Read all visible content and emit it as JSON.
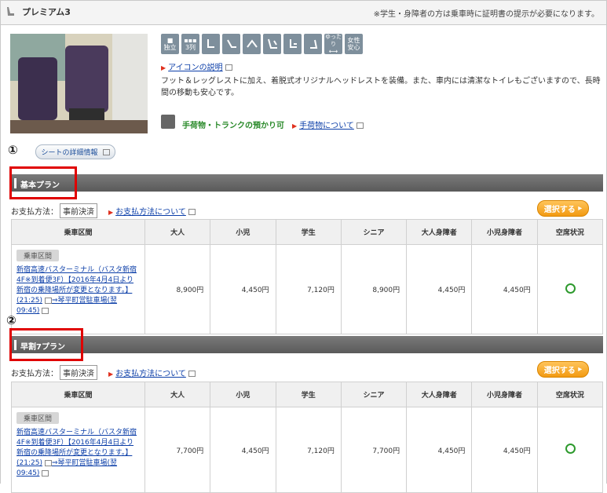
{
  "header": {
    "title": "プレミアム3",
    "notice": "※学生・身障者の方は乗車時に証明書の提示が必要になります。"
  },
  "icons": [
    {
      "name": "private-seat-icon",
      "label": "独立"
    },
    {
      "name": "three-row-icon",
      "label": "3列"
    },
    {
      "name": "seat-icon",
      "label": ""
    },
    {
      "name": "legrest-icon",
      "label": ""
    },
    {
      "name": "footrest-icon",
      "label": ""
    },
    {
      "name": "reclining-icon",
      "label": ""
    },
    {
      "name": "headrest-icon",
      "label": ""
    },
    {
      "name": "seat-back-icon",
      "label": ""
    },
    {
      "name": "spacious-icon",
      "label": "ゆったり"
    },
    {
      "name": "women-safe-icon",
      "label": "女性安心"
    }
  ],
  "icon_help_link": "アイコンの説明",
  "description": "フット＆レッグレストに加え、着脱式オリジナルヘッドレストを装備。また、車内には清潔なトイレもございますので、長時間の移動も安心です。",
  "baggage": {
    "label": "手荷物・トランクの預かり可",
    "link": "手荷物について"
  },
  "seat_button": "シートの詳細情報",
  "markers": {
    "one": "①",
    "two": "②"
  },
  "plans": [
    {
      "name": "基本プラン",
      "payment_label": "お支払方法：",
      "payment_value": "事前決済",
      "payment_link": "お支払方法について",
      "select_label": "選択する",
      "headers": [
        "乗車区間",
        "大人",
        "小児",
        "学生",
        "シニア",
        "大人身障者",
        "小児身障者",
        "空席状況"
      ],
      "row": {
        "tag": "乗車区間",
        "route": "新宿高速バスターミナル（バスタ新宿4F※到着便3F）【2016年4月4日より新宿の乗降場所が変更となります。】(21:25)",
        "dest": "⇒琴平町営駐車場(翌09:45)",
        "prices": [
          "8,900円",
          "4,450円",
          "7,120円",
          "8,900円",
          "4,450円",
          "4,450円"
        ]
      }
    },
    {
      "name": "早割7プラン",
      "payment_label": "お支払方法：",
      "payment_value": "事前決済",
      "payment_link": "お支払方法について",
      "select_label": "選択する",
      "headers": [
        "乗車区間",
        "大人",
        "小児",
        "学生",
        "シニア",
        "大人身障者",
        "小児身障者",
        "空席状況"
      ],
      "row": {
        "tag": "乗車区間",
        "route": "新宿高速バスターミナル（バスタ新宿4F※到着便3F）【2016年4月4日より新宿の乗降場所が変更となります。】(21:25)",
        "dest": "⇒琴平町営駐車場(翌09:45)",
        "prices": [
          "7,700円",
          "4,450円",
          "7,120円",
          "7,700円",
          "4,450円",
          "4,450円"
        ]
      }
    }
  ]
}
